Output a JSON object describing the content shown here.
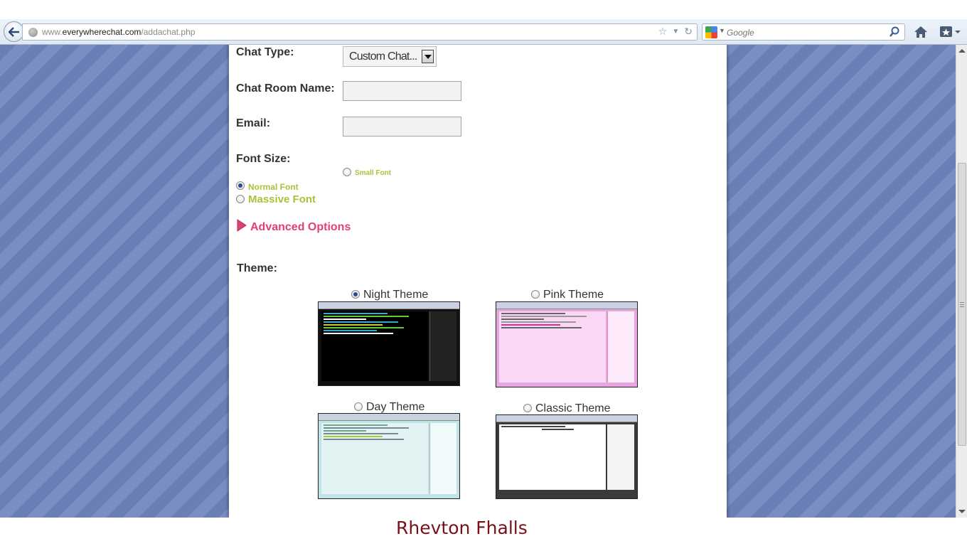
{
  "browser": {
    "url_prefix": "www.",
    "url_domain": "everywherechat.com",
    "url_path": "/addachat.php",
    "search_placeholder": "Google"
  },
  "form": {
    "chat_type": {
      "label": "Chat Type:",
      "value": "Custom Chat..."
    },
    "room_name": {
      "label": "Chat Room Name:",
      "value": ""
    },
    "email": {
      "label": "Email:",
      "value": ""
    },
    "font_size": {
      "label": "Font Size:",
      "options": [
        {
          "label": "Small Font",
          "checked": false
        },
        {
          "label": "Normal Font",
          "checked": true
        },
        {
          "label": "Massive Font",
          "checked": false
        }
      ]
    },
    "advanced_options": "Advanced Options",
    "theme": {
      "label": "Theme:",
      "options": [
        {
          "label": "Night Theme",
          "checked": true
        },
        {
          "label": "Pink Theme",
          "checked": false
        },
        {
          "label": "Day Theme",
          "checked": false
        },
        {
          "label": "Classic Theme",
          "checked": false
        }
      ]
    }
  },
  "watermark": "Rhevton Fhalls",
  "colors": {
    "font_option": "#a7c33a",
    "advanced_options": "#e0407a",
    "page_background": "#7a8ec2",
    "watermark": "#7a0f1a"
  }
}
